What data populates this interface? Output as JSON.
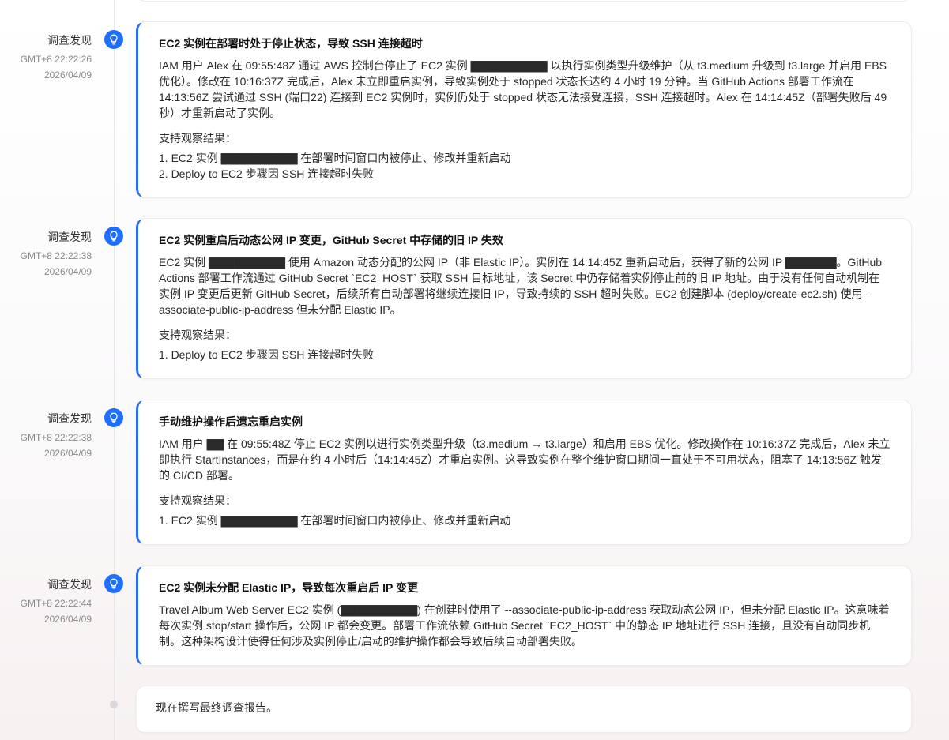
{
  "entries": [
    {
      "label": "调查发现",
      "time": "GMT+8 22:22:26",
      "date": "2026/04/09",
      "title": "EC2 实例在部署时处于停止状态，导致 SSH 连接超时",
      "body": "IAM 用户 Alex 在 09:55:48Z 通过 AWS 控制台停止了 EC2 实例 ▇▇▇▇▇▇▇▇▇ 以执行实例类型升级维护（从 t3.medium 升级到 t3.large 并启用 EBS 优化）。修改在 10:16:37Z 完成后，Alex 未立即重启实例，导致实例处于 stopped 状态长达约 4 小时 19 分钟。当 GitHub Actions 部署工作流在 14:13:56Z 尝试通过 SSH (端口22) 连接到 EC2 实例时，实例仍处于 stopped 状态无法接受连接，SSH 连接超时。Alex 在 14:14:45Z（部署失败后 49 秒）才重新启动了实例。",
      "support_label": "支持观察结果：",
      "support": [
        "1. EC2 实例 ▇▇▇▇▇▇▇▇▇ 在部署时间窗口内被停止、修改并重新启动",
        "2. Deploy to EC2 步骤因 SSH 连接超时失败"
      ]
    },
    {
      "label": "调查发现",
      "time": "GMT+8 22:22:38",
      "date": "2026/04/09",
      "title": "EC2 实例重启后动态公网 IP 变更，GitHub Secret 中存储的旧 IP 失效",
      "body": "EC2 实例 ▇▇▇▇▇▇▇▇▇ 使用 Amazon 动态分配的公网 IP（非 Elastic IP）。实例在 14:14:45Z 重新启动后，获得了新的公网 IP ▇▇▇▇▇▇。GitHub Actions 部署工作流通过 GitHub Secret `EC2_HOST` 获取 SSH 目标地址，该 Secret 中仍存储着实例停止前的旧 IP 地址。由于没有任何自动机制在实例 IP 变更后更新 GitHub Secret，后续所有自动部署将继续连接旧 IP，导致持续的 SSH 超时失败。EC2 创建脚本 (deploy/create-ec2.sh) 使用 --associate-public-ip-address 但未分配 Elastic IP。",
      "support_label": "支持观察结果：",
      "support": [
        "1. Deploy to EC2 步骤因 SSH 连接超时失败"
      ]
    },
    {
      "label": "调查发现",
      "time": "GMT+8 22:22:38",
      "date": "2026/04/09",
      "title": "手动维护操作后遗忘重启实例",
      "body": "IAM 用户 ▇▇ 在 09:55:48Z 停止 EC2 实例以进行实例类型升级（t3.medium → t3.large）和启用 EBS 优化。修改操作在 10:16:37Z 完成后，Alex 未立即执行 StartInstances，而是在约 4 小时后（14:14:45Z）才重启实例。这导致实例在整个维护窗口期间一直处于不可用状态，阻塞了 14:13:56Z 触发的 CI/CD 部署。",
      "support_label": "支持观察结果：",
      "support": [
        "1. EC2 实例 ▇▇▇▇▇▇▇▇▇ 在部署时间窗口内被停止、修改并重新启动"
      ]
    },
    {
      "label": "调查发现",
      "time": "GMT+8 22:22:44",
      "date": "2026/04/09",
      "title": "EC2 实例未分配 Elastic IP，导致每次重启后 IP 变更",
      "body": "Travel Album Web Server EC2 实例 (▇▇▇▇▇▇▇▇▇) 在创建时使用了 --associate-public-ip-address 获取动态公网 IP，但未分配 Elastic IP。这意味着每次实例 stop/start 操作后，公网 IP 都会变更。部署工作流依赖 GitHub Secret `EC2_HOST` 中的静态 IP 地址进行 SSH 连接，且没有自动同步机制。这种架构设计使得任何涉及实例停止/启动的维护操作都会导致后续自动部署失败。",
      "support_label": "",
      "support": []
    }
  ],
  "final_message": "现在撰写最终调查报告。",
  "colors": {
    "accent": "#2c6df5",
    "icon": "#1f6fff"
  },
  "icons": {
    "entry": "lightbulb-icon",
    "final": "timeline-dot"
  }
}
